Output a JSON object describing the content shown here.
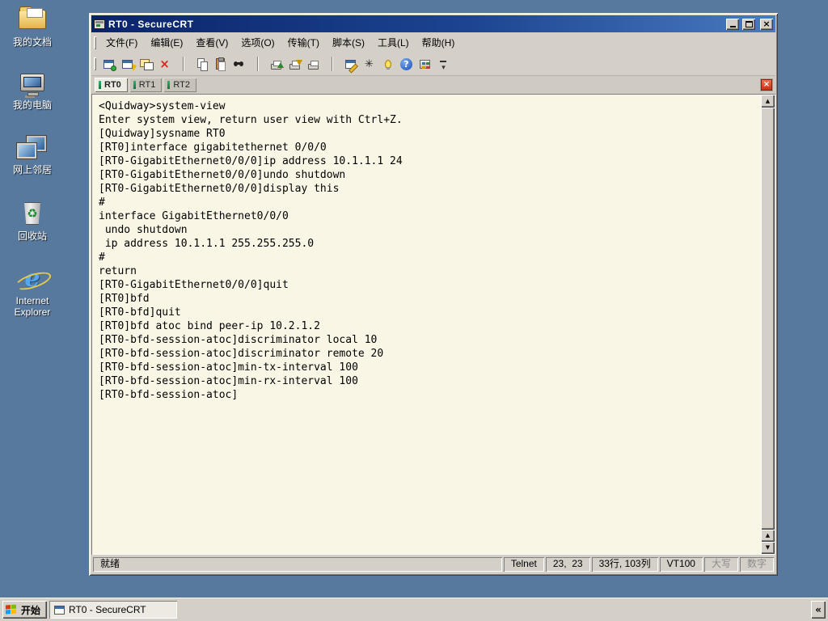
{
  "desktop": {
    "icons": [
      {
        "label": "我的文档"
      },
      {
        "label": "我的电脑"
      },
      {
        "label": "网上邻居"
      },
      {
        "label": "回收站"
      },
      {
        "label": "Internet Explorer"
      }
    ],
    "recycle_glyph": "♻",
    "ie_glyph": "e"
  },
  "window": {
    "title": "RT0 - SecureCRT",
    "close_glyph": "×",
    "menu": [
      {
        "name": "menu-item-file",
        "label": "文件(F)"
      },
      {
        "name": "menu-item-edit",
        "label": "编辑(E)"
      },
      {
        "name": "menu-item-view",
        "label": "查看(V)"
      },
      {
        "name": "menu-item-options",
        "label": "选项(O)"
      },
      {
        "name": "menu-item-transfer",
        "label": "传输(T)"
      },
      {
        "name": "menu-item-script",
        "label": "脚本(S)"
      },
      {
        "name": "menu-item-tools",
        "label": "工具(L)"
      },
      {
        "name": "menu-item-help",
        "label": "帮助(H)"
      }
    ],
    "toolbar": [
      {
        "name": "connect-icon",
        "cls": "ti ti-win ti-connect",
        "interactable": "true"
      },
      {
        "name": "quick-connect-icon",
        "cls": "ti ti-win ti-bolt",
        "interactable": "true"
      },
      {
        "name": "connect-in-tab-icon",
        "cls": "ti ti-tabs",
        "interactable": "true"
      },
      {
        "name": "disconnect-icon",
        "cls": "ti ti-x",
        "glyph": "×",
        "interactable": "true"
      },
      {
        "name": "toolbar-separator",
        "cls": "tsep",
        "interactable": "false"
      },
      {
        "name": "copy-icon",
        "cls": "ti ti-copy",
        "interactable": "true"
      },
      {
        "name": "paste-icon",
        "cls": "ti ti-paste",
        "interactable": "true"
      },
      {
        "name": "find-icon",
        "cls": "ti ti-find",
        "interactable": "true"
      },
      {
        "name": "toolbar-separator",
        "cls": "tsep",
        "interactable": "false"
      },
      {
        "name": "send-file-icon",
        "cls": "ti ti-print ti-up",
        "interactable": "true"
      },
      {
        "name": "receive-file-icon",
        "cls": "ti ti-print ti-dn",
        "interactable": "true"
      },
      {
        "name": "print-icon",
        "cls": "ti ti-print",
        "interactable": "true"
      },
      {
        "name": "toolbar-separator",
        "cls": "tsep",
        "interactable": "false"
      },
      {
        "name": "session-options-icon",
        "cls": "ti ti-win ti-pencil",
        "interactable": "true"
      },
      {
        "name": "keyword-highlight-icon",
        "cls": "ti ti-star",
        "glyph": "✳",
        "interactable": "true"
      },
      {
        "name": "bulb-icon",
        "cls": "ti ti-bulb",
        "interactable": "true"
      },
      {
        "name": "help-icon",
        "cls": "ti ti-help",
        "glyph": "?",
        "interactable": "true"
      },
      {
        "name": "app-grid-icon",
        "cls": "ti ti-grid",
        "interactable": "true"
      },
      {
        "name": "toolbar-overflow-icon",
        "cls": "ti ti-more",
        "glyph": "▾",
        "interactable": "true"
      }
    ],
    "tabs": [
      {
        "name": "tab-rt0",
        "label": "RT0",
        "cls": "active"
      },
      {
        "name": "tab-rt1",
        "label": "RT1",
        "cls": ""
      },
      {
        "name": "tab-rt2",
        "label": "RT2",
        "cls": ""
      }
    ],
    "tab_close_glyph": "×",
    "terminal": {
      "lines": [
        "<Quidway>system-view",
        "Enter system view, return user view with Ctrl+Z.",
        "[Quidway]sysname RT0",
        "[RT0]interface gigabitethernet 0/0/0",
        "[RT0-GigabitEthernet0/0/0]ip address 10.1.1.1 24",
        "[RT0-GigabitEthernet0/0/0]undo shutdown",
        "[RT0-GigabitEthernet0/0/0]display this",
        "#",
        "interface GigabitEthernet0/0/0",
        " undo shutdown",
        " ip address 10.1.1.1 255.255.255.0",
        "#",
        "return",
        "[RT0-GigabitEthernet0/0/0]quit",
        "[RT0]bfd",
        "[RT0-bfd]quit",
        "[RT0]bfd atoc bind peer-ip 10.2.1.2",
        "[RT0-bfd-session-atoc]discriminator local 10",
        "[RT0-bfd-session-atoc]discriminator remote 20",
        "[RT0-bfd-session-atoc]min-tx-interval 100",
        "[RT0-bfd-session-atoc]min-rx-interval 100",
        "[RT0-bfd-session-atoc]"
      ]
    },
    "scrollbar": {
      "up": "▲",
      "down": "▼"
    },
    "status": {
      "ready": "就绪",
      "protocol": "Telnet",
      "cursor": "23,  23",
      "size": "33行, 103列",
      "emulation": "VT100",
      "caps": "大写",
      "num": "数字"
    }
  },
  "taskbar": {
    "start_label": "开始",
    "task_label": "RT0 - SecureCRT",
    "chevron": "«"
  }
}
